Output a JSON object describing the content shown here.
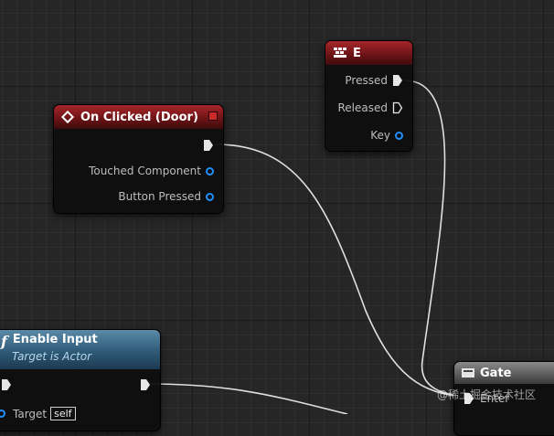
{
  "colors": {
    "exec_pin": "#e6e6e6",
    "data_pin": "#1e90ff",
    "event_header": "#8b1a1d",
    "function_header": "#3a6b8c",
    "macro_header": "#6a6a6a",
    "wire": "#e8e8e8"
  },
  "nodes": {
    "on_clicked": {
      "title": "On Clicked (Door)",
      "icon": "event-diamond-icon",
      "pins": {
        "touched_component": "Touched Component",
        "button_pressed": "Button Pressed"
      }
    },
    "key_e": {
      "title": "E",
      "icon": "keyboard-icon",
      "pins": {
        "pressed": "Pressed",
        "released": "Released",
        "key": "Key"
      }
    },
    "enable_input": {
      "title": "Enable Input",
      "subtitle": "Target is Actor",
      "icon": "function-icon",
      "pins": {
        "target": "Target",
        "target_value": "self"
      }
    },
    "gate": {
      "title": "Gate",
      "icon": "macro-icon",
      "pins": {
        "enter": "Enter"
      }
    }
  },
  "watermark": "@稀土掘金技术社区"
}
